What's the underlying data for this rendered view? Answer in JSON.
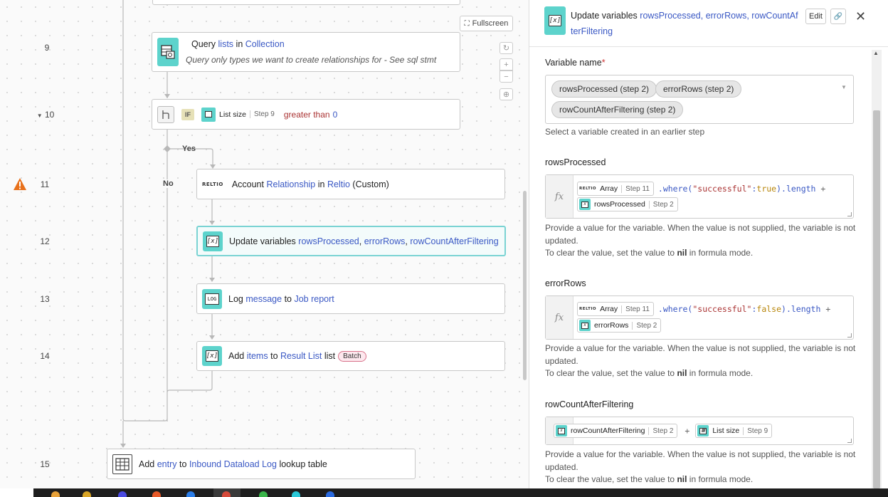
{
  "canvas": {
    "fullscreen_label": "Fullscreen",
    "steps": {
      "s9": {
        "num": "9",
        "pre": "Query",
        "noun": "lists",
        "mid": "in",
        "target": "Collection",
        "subtitle": "Query only types we want to create relationships for - See sql stmt"
      },
      "s10": {
        "num": "10",
        "badge": "IF",
        "pill_label": "List size",
        "pill_step": "Step 9",
        "op": "greater than",
        "value": "0"
      },
      "s11": {
        "num": "11",
        "logo": "RELTIO",
        "pre": "Account",
        "noun": "Relationship",
        "mid": "in",
        "target": "Reltio",
        "suffix": "(Custom)"
      },
      "s12": {
        "num": "12",
        "pre": "Update variables",
        "v1": "rowsProcessed",
        "v2": "errorRows",
        "v3": "rowCountAfterFiltering",
        "sep": ","
      },
      "s13": {
        "num": "13",
        "pre": "Log",
        "noun": "message",
        "mid": "to",
        "target": "Job report",
        "icon_text": "LOG"
      },
      "s14": {
        "num": "14",
        "pre": "Add",
        "noun": "items",
        "mid": "to",
        "target": "Result List",
        "suffix": "list",
        "badge": "Batch"
      },
      "s15": {
        "num": "15",
        "pre": "Add",
        "noun": "entry",
        "mid": "to",
        "target": "Inbound Dataload Log",
        "suffix": "lookup table"
      }
    },
    "branch_yes": "Yes",
    "branch_no": "No"
  },
  "panel": {
    "title_pre": "Update variables",
    "title_vars": "rowsProcessed, errorRows, rowCountAfterFiltering",
    "edit_label": "Edit",
    "variable_name_label": "Variable name",
    "required_mark": "*",
    "chips": [
      "rowsProcessed (step 2)",
      "errorRows (step 2)",
      "rowCountAfterFiltering (step 2)"
    ],
    "variable_help": "Select a variable created in an earlier step",
    "help_line1": "Provide a value for the variable. When the value is not supplied, the variable is not updated.",
    "help_line2_pre": "To clear the value, set the value to",
    "help_nil": "nil",
    "help_line2_post": "in formula mode.",
    "fx": "fx",
    "fields": {
      "rowsProcessed": {
        "label": "rowsProcessed",
        "pill1": {
          "logo": "RELTIO",
          "label": "Array",
          "step": "Step 11"
        },
        "code": {
          "dot_where": ".where(",
          "str": "\"successful\"",
          "colon": ":",
          "val": "true",
          "tail": ").length",
          "plus": "+"
        },
        "pill2": {
          "label": "rowsProcessed",
          "step": "Step 2"
        }
      },
      "errorRows": {
        "label": "errorRows",
        "pill1": {
          "logo": "RELTIO",
          "label": "Array",
          "step": "Step 11"
        },
        "code": {
          "dot_where": ".where(",
          "str": "\"successful\"",
          "colon": ":",
          "val": "false",
          "tail": ").length",
          "plus": "+"
        },
        "pill2": {
          "label": "errorRows",
          "step": "Step 2"
        }
      },
      "rowCountAfterFiltering": {
        "label": "rowCountAfterFiltering",
        "pill1": {
          "label": "rowCountAfterFiltering",
          "step": "Step 2"
        },
        "plus": "+",
        "pill2": {
          "label": "List size",
          "step": "Step 9"
        }
      }
    }
  },
  "colors": {
    "accent": "#5dd3cc",
    "link": "#3a58c4",
    "warning": "#e8711c"
  }
}
